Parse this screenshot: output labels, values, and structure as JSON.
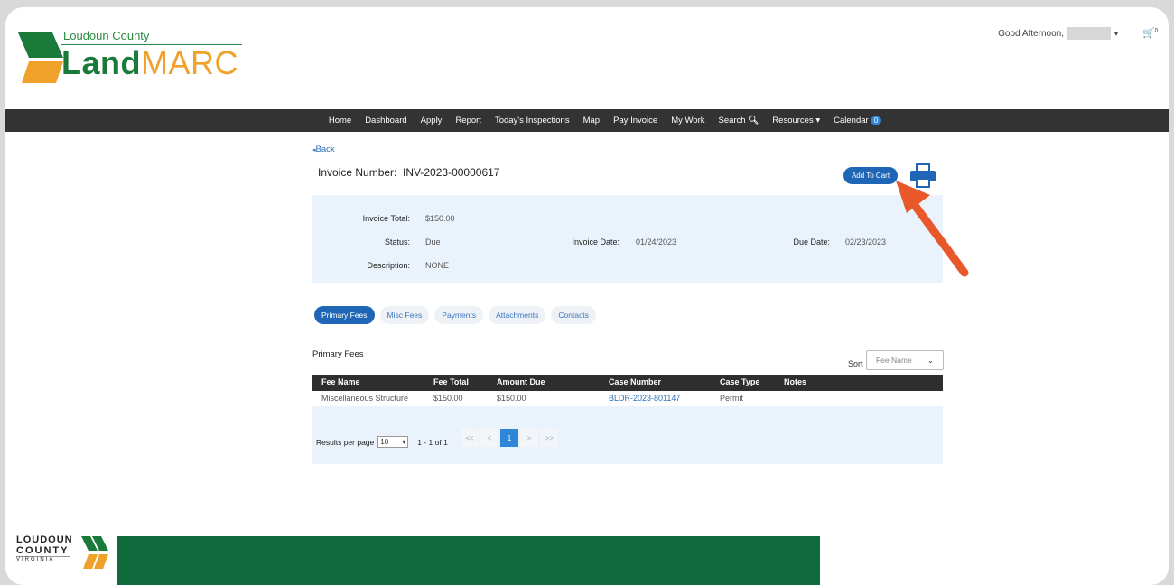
{
  "header": {
    "brand_small": "Loudoun County",
    "brand_land": "Land",
    "brand_marc": "MARC",
    "greeting": "Good Afternoon,",
    "cart_count": "0"
  },
  "nav": {
    "items": [
      "Home",
      "Dashboard",
      "Apply",
      "Report",
      "Today's Inspections",
      "Map",
      "Pay Invoice",
      "My Work",
      "Search",
      "Resources",
      "Calendar"
    ],
    "calendar_badge": "0"
  },
  "page": {
    "back": "Back",
    "invoice_label": "Invoice Number:",
    "invoice_number": "INV-2023-00000617",
    "add_to_cart": "Add To Cart"
  },
  "details": {
    "invoice_total_label": "Invoice Total:",
    "invoice_total": "$150.00",
    "status_label": "Status:",
    "status": "Due",
    "description_label": "Description:",
    "description": "NONE",
    "invoice_date_label": "Invoice Date:",
    "invoice_date": "01/24/2023",
    "due_date_label": "Due Date:",
    "due_date": "02/23/2023"
  },
  "tabs": [
    "Primary Fees",
    "Misc Fees",
    "Payments",
    "Attachments",
    "Contacts"
  ],
  "fees": {
    "title": "Primary Fees",
    "sort_label": "Sort",
    "sort_value": "Fee Name",
    "columns": [
      "Fee Name",
      "Fee Total",
      "Amount Due",
      "Case Number",
      "Case Type",
      "Notes"
    ],
    "rows": [
      [
        "Miscellaneous Structure",
        "$150.00",
        "$150.00",
        "BLDR-2023-801147",
        "Permit",
        ""
      ]
    ]
  },
  "pager": {
    "rpp_label": "Results per page",
    "rpp_value": "10",
    "range": "1 - 1 of 1",
    "first": "<<",
    "prev": "<",
    "current": "1",
    "next": ">",
    "last": ">>"
  },
  "footer": {
    "line1": "LOUDOUN",
    "line2": "COUNTY",
    "line3": "VIRGINIA"
  },
  "colors": {
    "brand_green": "#1a7a3a",
    "brand_gold": "#f0a12a",
    "accent_blue": "#1f67b6",
    "nav_bg": "#333333",
    "arrow": "#e8582a"
  }
}
